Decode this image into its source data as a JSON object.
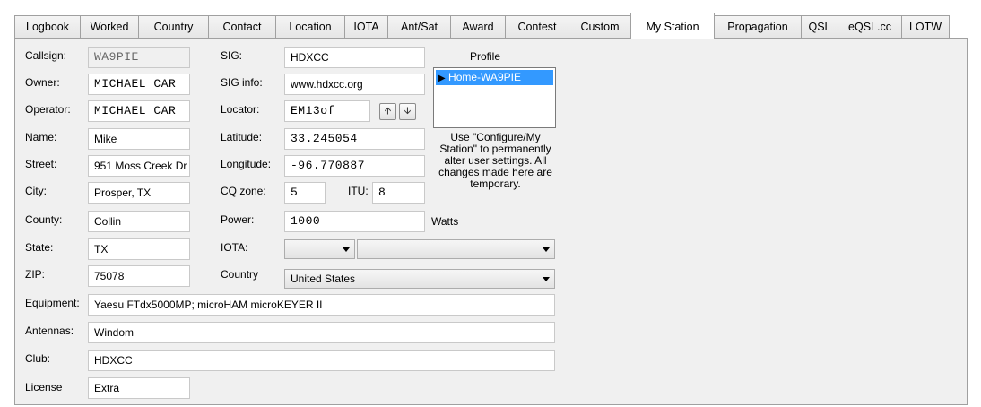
{
  "tabs": [
    "Logbook",
    "Worked",
    "Country",
    "Contact",
    "Location",
    "IOTA",
    "Ant/Sat",
    "Award",
    "Contest",
    "Custom",
    "My Station",
    "Propagation",
    "QSL",
    "eQSL.cc",
    "LOTW"
  ],
  "active_tab": "My Station",
  "left": {
    "callsign_label": "Callsign:",
    "callsign_value": "WA9PIE",
    "owner_label": "Owner:",
    "owner_value": "MICHAEL CAR",
    "operator_label": "Operator:",
    "operator_value": "MICHAEL CAR",
    "name_label": "Name:",
    "name_value": "Mike",
    "street_label": "Street:",
    "street_value": "951 Moss Creek Dr",
    "city_label": "City:",
    "city_value": "Prosper, TX",
    "county_label": "County:",
    "county_value": "Collin",
    "state_label": "State:",
    "state_value": "TX",
    "zip_label": "ZIP:",
    "zip_value": "75078",
    "equipment_label": "Equipment:",
    "equipment_value": "Yaesu FTdx5000MP; microHAM microKEYER II",
    "antennas_label": "Antennas:",
    "antennas_value": "Windom",
    "club_label": "Club:",
    "club_value": "HDXCC",
    "license_label": "License",
    "license_value": "Extra"
  },
  "middle": {
    "sig_label": "SIG:",
    "sig_value": "HDXCC",
    "siginfo_label": "SIG info:",
    "siginfo_value": "www.hdxcc.org",
    "locator_label": "Locator:",
    "locator_value": "EM13of",
    "latitude_label": "Latitude:",
    "latitude_value": "33.245054",
    "longitude_label": "Longitude:",
    "longitude_value": "-96.770887",
    "cqzone_label": "CQ zone:",
    "cqzone_value": "5",
    "itu_label": "ITU:",
    "itu_value": "8",
    "power_label": "Power:",
    "power_value": "1000",
    "power_unit": "Watts",
    "iota_label": "IOTA:",
    "iota_value1": "",
    "iota_value2": "",
    "country_label": "Country",
    "country_value": "United States"
  },
  "profile": {
    "label": "Profile",
    "selected": "Home-WA9PIE",
    "note": "Use \"Configure/My Station\" to permanently alter user settings.  All changes made here are temporary."
  },
  "icons": {
    "up": "arrow-up-icon",
    "down": "arrow-down-icon",
    "play": "play-marker-icon"
  }
}
